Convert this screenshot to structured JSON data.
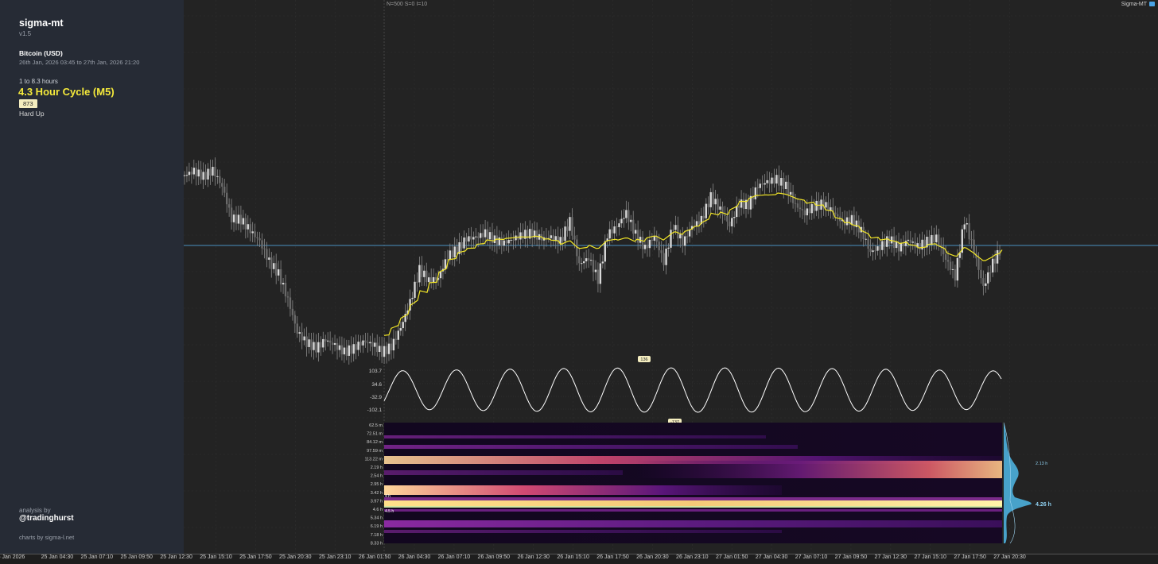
{
  "sidebar": {
    "app_title": "sigma-mt",
    "version": "v1.5",
    "instrument": "Bitcoin (USD)",
    "date_range": "26th Jan, 2026 03:45 to 27th Jan, 2026 21:20",
    "range_label": "1 to 8.3 hours",
    "cycle_title": "4.3 Hour Cycle (M5)",
    "badge": "873",
    "trend": "Hard Up",
    "analysis_label": "analysis by",
    "handle": "@tradinghurst",
    "credit": "charts by sigma-l.net"
  },
  "header": {
    "params": "N=500  S=0  I=10",
    "brand": "Sigma-MT"
  },
  "colors": {
    "background": "#232323",
    "sidebar": "#262b35",
    "fit_line": "#f2e627",
    "reference_line": "#4a90c2",
    "cycle_wave": "#ffffff",
    "peak_marker": "#4fb8e8",
    "cycle_title": "#f5ea3b"
  },
  "x_axis": {
    "labels": [
      "25 Jan 2026",
      "25 Jan 04:30",
      "25 Jan 07:10",
      "25 Jan 09:50",
      "25 Jan 12:30",
      "25 Jan 15:10",
      "25 Jan 17:50",
      "25 Jan 20:30",
      "25 Jan 23:10",
      "26 Jan 01:50",
      "26 Jan 04:30",
      "26 Jan 07:10",
      "26 Jan 09:50",
      "26 Jan 12:30",
      "26 Jan 15:10",
      "26 Jan 17:50",
      "26 Jan 20:30",
      "26 Jan 23:10",
      "27 Jan 01:50",
      "27 Jan 04:30",
      "27 Jan 07:10",
      "27 Jan 09:50",
      "27 Jan 12:30",
      "27 Jan 15:10",
      "27 Jan 17:50",
      "27 Jan 20:30"
    ]
  },
  "chart_data": [
    {
      "type": "line",
      "name": "price",
      "series": [
        {
          "values": [
            5.2,
            5.5,
            5.1,
            5.6,
            4.4,
            2.0,
            1.9,
            1.1,
            0.3,
            -1.2,
            -2.1,
            -4.0,
            -6.4,
            -7.2,
            -7.6,
            -7.0,
            -7.4,
            -7.9,
            -7.6,
            -7.1,
            -7.3,
            -7.9,
            -7.5,
            -6.1,
            -4.2,
            -1.8,
            -2.6,
            -2.4,
            -0.8,
            -0.3,
            0.5,
            0.6,
            0.9,
            0.4,
            0.2,
            0.5,
            0.8,
            0.9,
            0.5,
            0.6,
            0.3,
            1.8,
            -1.4,
            -0.9,
            -2.5,
            0.8,
            1.4,
            2.4,
            0.8,
            -0.2,
            0.7,
            -1.2,
            1.5,
            0.2,
            1.4,
            1.9,
            3.6,
            2.7,
            1.5,
            3.1,
            3.0,
            4.4,
            4.7,
            4.9,
            4.4,
            3.0,
            2.4,
            2.9,
            3.1,
            2.5,
            1.7,
            1.9,
            1.1,
            -0.5,
            -0.1,
            0.5,
            -0.2,
            0.4,
            -0.1,
            0.3,
            0.6,
            -1.0,
            -2.3,
            1.9,
            -0.4,
            -3.1,
            -1.3,
            -0.1
          ]
        }
      ]
    },
    {
      "type": "line",
      "name": "cycle",
      "ticks": [
        "103.7",
        "34.6",
        "-32.9",
        "-102.1"
      ],
      "peak_label": "136",
      "trough_label": "-137"
    },
    {
      "type": "heatmap",
      "y_labels": [
        "62.5 m",
        "72.51 m",
        "84.12 m",
        "97.59 m",
        "113.22 m",
        "2.19 h",
        "2.54 h",
        "2.95 h",
        "3.42 h",
        "3.97 h",
        "4.6 h",
        "5.34 h",
        "6.19 h",
        "7.18 h",
        "8.33 h"
      ],
      "band_labels": [
        "4 h",
        "4.5 h"
      ],
      "spectrum_labels": [
        "2.13 h",
        "4.26 h"
      ]
    }
  ]
}
